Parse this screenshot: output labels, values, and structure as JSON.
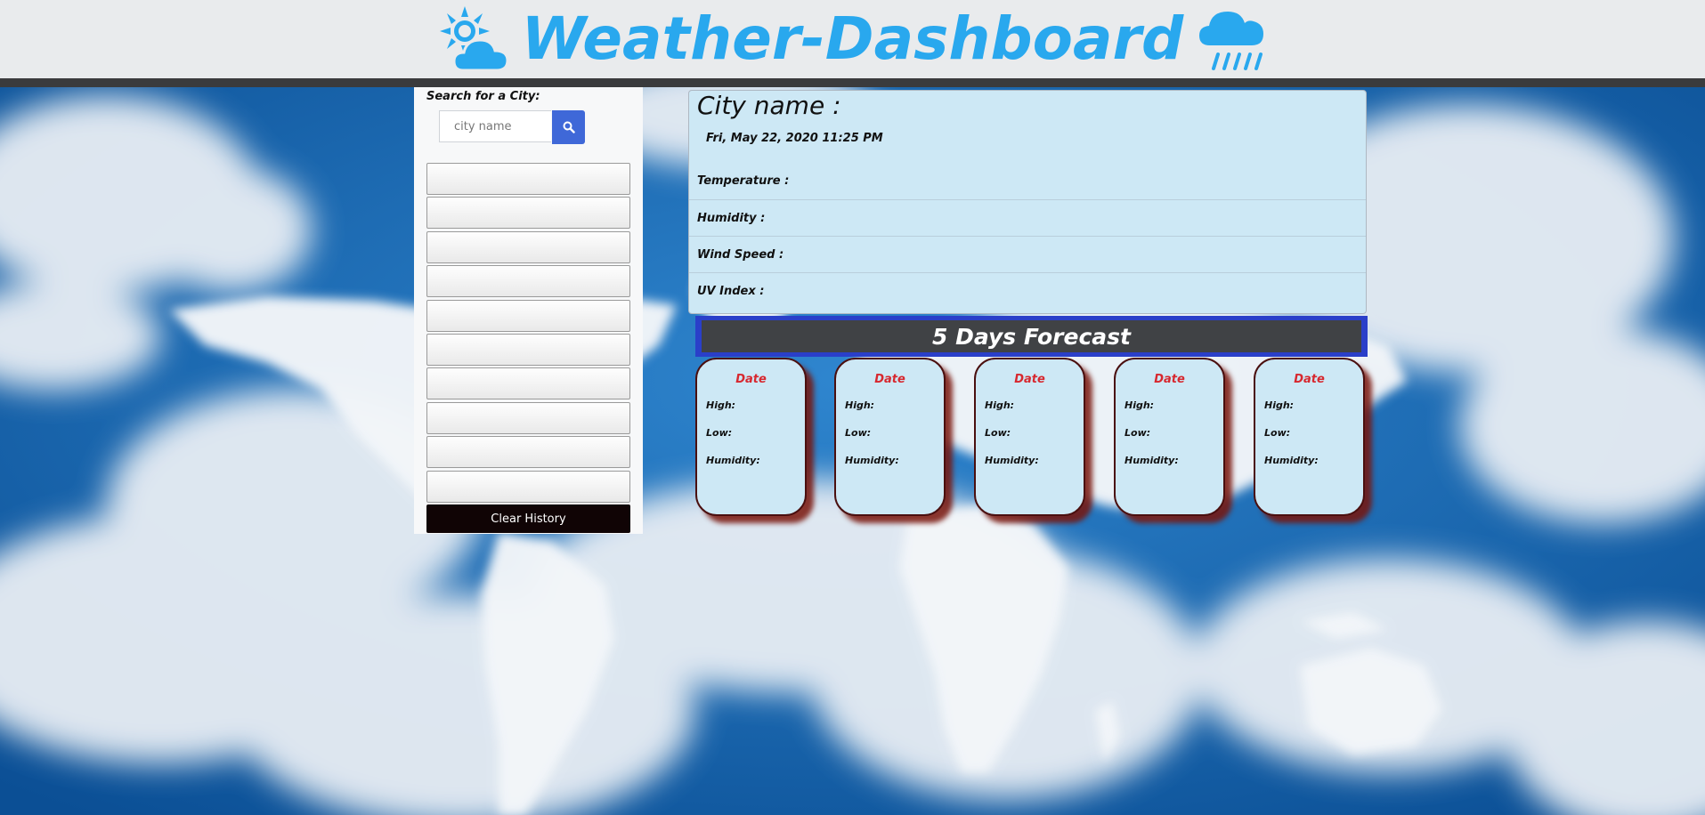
{
  "header": {
    "title": "Weather-Dashboard",
    "left_icon": "sun-cloud-icon",
    "right_icon": "rain-cloud-icon",
    "title_color": "#29a8ee"
  },
  "search": {
    "label": "Search for a City:",
    "placeholder": "city name",
    "value": "",
    "button_icon": "search-icon",
    "history": [
      "",
      "",
      "",
      "",
      "",
      "",
      "",
      "",
      "",
      ""
    ],
    "clear_label": "Clear History"
  },
  "current": {
    "city_label": "City name :",
    "date": "Fri, May 22, 2020 11:25 PM",
    "temperature_label": "Temperature :",
    "humidity_label": "Humidity :",
    "wind_label": "Wind Speed :",
    "uv_label": "UV Index :"
  },
  "forecast": {
    "title": "5 Days Forecast",
    "days": [
      {
        "date": "Date",
        "high": "High:",
        "low": "Low:",
        "humidity": "Humidity:"
      },
      {
        "date": "Date",
        "high": "High:",
        "low": "Low:",
        "humidity": "Humidity:"
      },
      {
        "date": "Date",
        "high": "High:",
        "low": "Low:",
        "humidity": "Humidity:"
      },
      {
        "date": "Date",
        "high": "High:",
        "low": "Low:",
        "humidity": "Humidity:"
      },
      {
        "date": "Date",
        "high": "High:",
        "low": "Low:",
        "humidity": "Humidity:"
      }
    ]
  },
  "colors": {
    "accent": "#29a8ee",
    "search_button": "#3f68d8",
    "forecast_banner_border": "#2a3fc9",
    "forecast_banner_bg": "#404245",
    "card_bg": "#cde8f5",
    "date_red": "#d7282f",
    "clear_button": "#100405"
  }
}
